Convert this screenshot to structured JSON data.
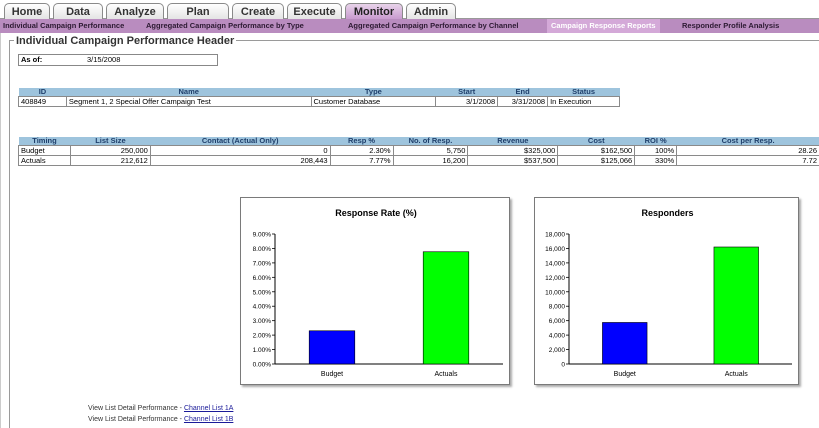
{
  "tabs": [
    "Home",
    "Data",
    "Analyze",
    "Plan",
    "Create",
    "Execute",
    "Monitor",
    "Admin"
  ],
  "subnav": [
    "Individual Campaign Performance",
    "Aggregated Campaign Performance by Type",
    "Aggregated Campaign Performance by Channel",
    "Campaign Response Reports",
    "Responder Profile Analysis"
  ],
  "section_title": "Individual Campaign Performance Header",
  "as_of": {
    "label": "As of:",
    "value": "3/15/2008"
  },
  "campaign_table": {
    "headers": [
      "ID",
      "Name",
      "Type",
      "Start",
      "End",
      "Status"
    ],
    "row": [
      "408849",
      "Segment 1, 2 Special Offer Campaign Test",
      "Customer Database",
      "3/1/2008",
      "3/31/2008",
      "In Execution"
    ]
  },
  "perf_table": {
    "headers": [
      "Timing",
      "List Size",
      "Contact (Actual Only)",
      "Resp %",
      "No. of Resp.",
      "Revenue",
      "Cost",
      "ROI %",
      "Cost per Resp."
    ],
    "rows": [
      [
        "Budget",
        "250,000",
        "0",
        "2.30%",
        "5,750",
        "$325,000",
        "$162,500",
        "100%",
        "28.26"
      ],
      [
        "Actuals",
        "212,612",
        "208,443",
        "7.77%",
        "16,200",
        "$537,500",
        "$125,066",
        "330%",
        "7.72"
      ]
    ]
  },
  "chart_data": [
    {
      "type": "bar",
      "title": "Response Rate (%)",
      "categories": [
        "Budget",
        "Actuals"
      ],
      "values": [
        2.3,
        7.77
      ],
      "colors": [
        "#0000ff",
        "#00ff00"
      ],
      "ylim": [
        0,
        9
      ],
      "yticks": [
        "0.00%",
        "1.00%",
        "2.00%",
        "3.00%",
        "4.00%",
        "5.00%",
        "6.00%",
        "7.00%",
        "8.00%",
        "9.00%"
      ],
      "ytick_values": [
        0,
        1,
        2,
        3,
        4,
        5,
        6,
        7,
        8,
        9
      ]
    },
    {
      "type": "bar",
      "title": "Responders",
      "categories": [
        "Budget",
        "Actuals"
      ],
      "values": [
        5750,
        16200
      ],
      "colors": [
        "#0000ff",
        "#00ff00"
      ],
      "ylim": [
        0,
        18000
      ],
      "yticks": [
        "0",
        "2,000",
        "4,000",
        "6,000",
        "8,000",
        "10,000",
        "12,000",
        "14,000",
        "16,000",
        "18,000"
      ],
      "ytick_values": [
        0,
        2000,
        4000,
        6000,
        8000,
        10000,
        12000,
        14000,
        16000,
        18000
      ]
    }
  ],
  "links": [
    {
      "prefix": "View List Detail Performance - ",
      "link": "Channel List 1A"
    },
    {
      "prefix": "View List Detail Performance - ",
      "link": "Channel List 1B"
    }
  ]
}
